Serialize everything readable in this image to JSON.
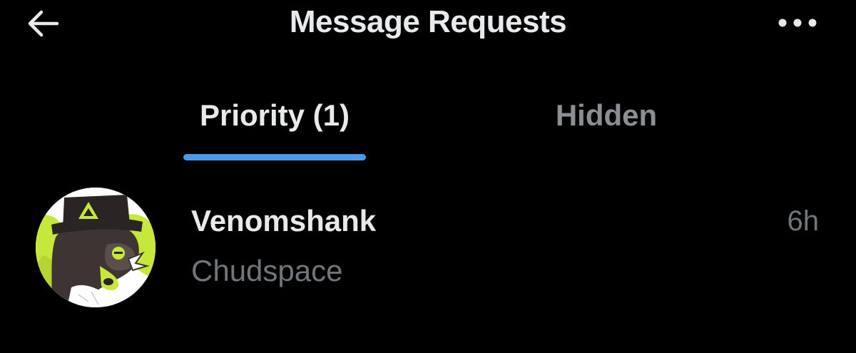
{
  "header": {
    "title": "Message Requests",
    "back_icon": "arrow-left-icon",
    "more_icon": "more-horizontal-icon"
  },
  "tabs": [
    {
      "label": "Priority (1)",
      "active": true
    },
    {
      "label": "Hidden",
      "active": false
    }
  ],
  "colors": {
    "background": "#000000",
    "text_primary": "#e7e9ea",
    "text_secondary": "#71767b",
    "accent": "#1d9bf0",
    "avatar_accent": "#c6e83a"
  },
  "requests": [
    {
      "name": "Venomshank",
      "preview": "Chudspace",
      "time": "6h",
      "avatar_icon": "avatar-icon"
    }
  ]
}
